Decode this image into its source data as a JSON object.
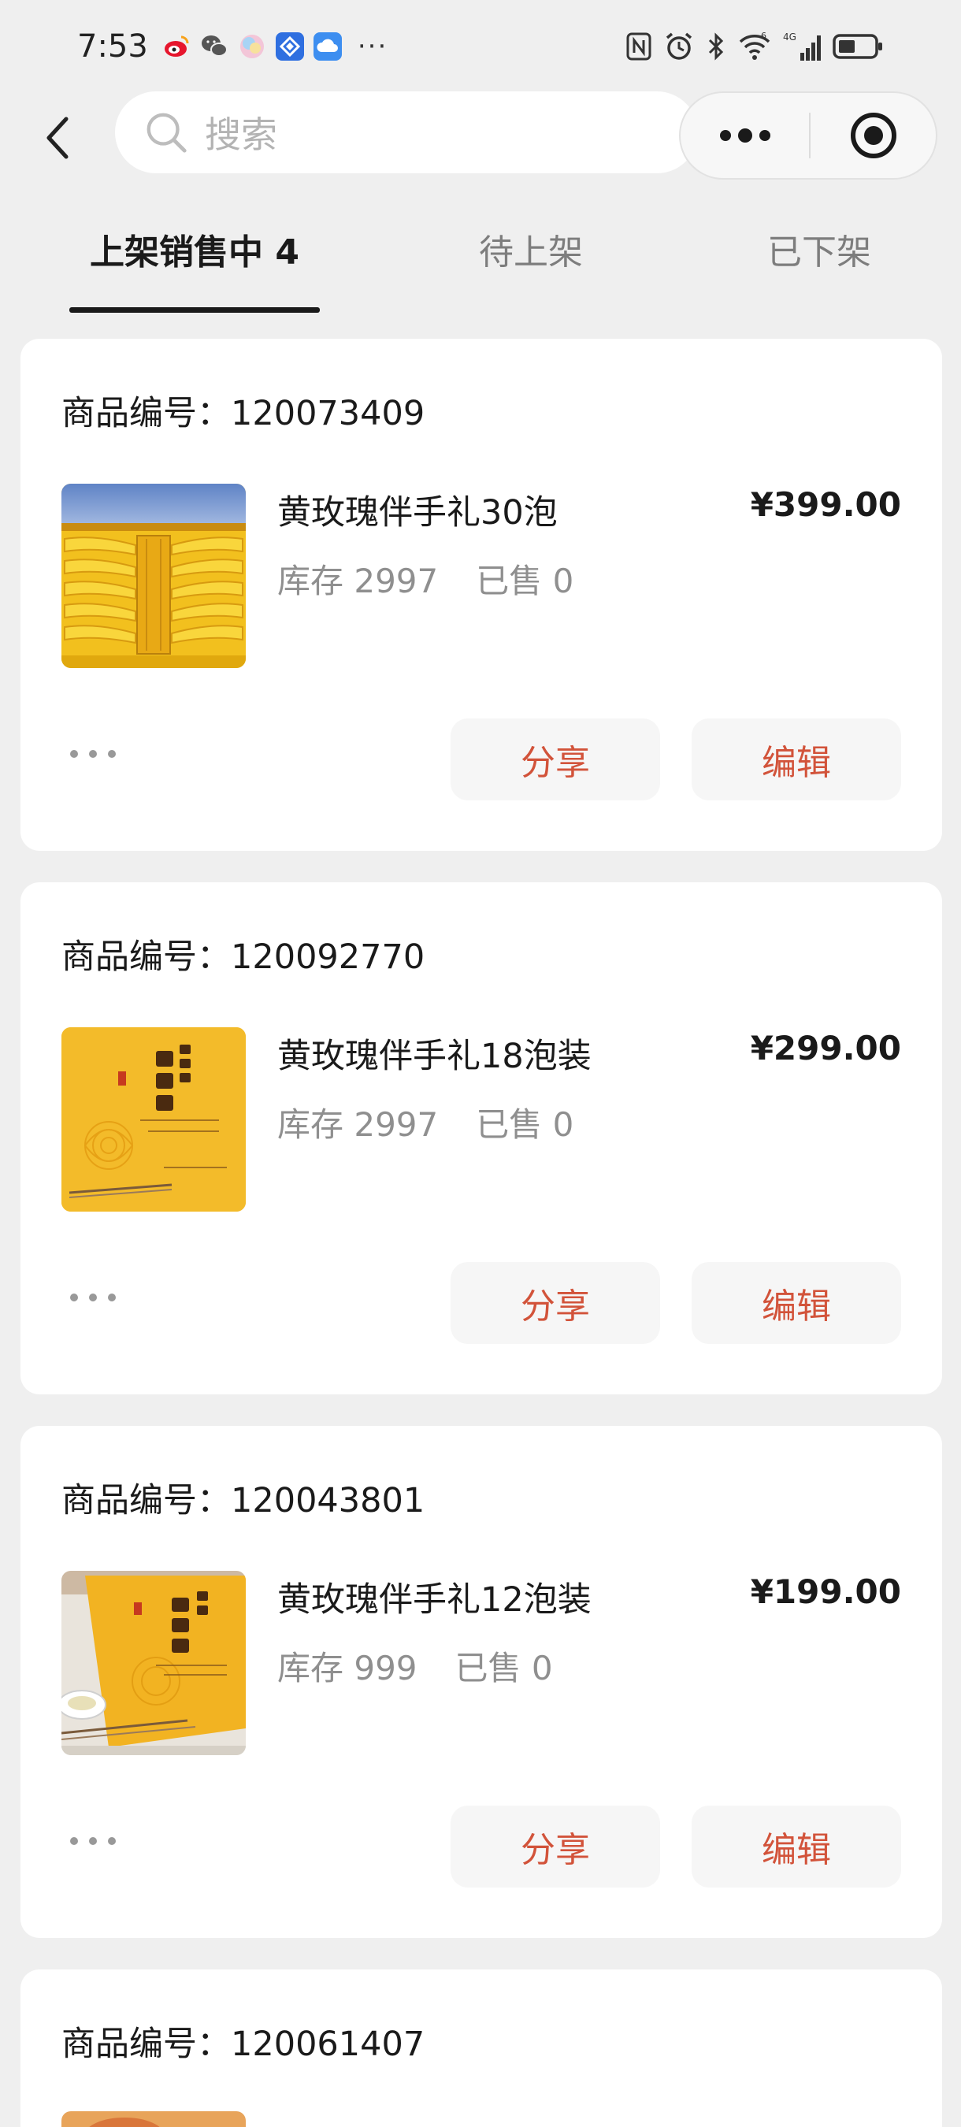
{
  "status_bar": {
    "time": "7:53",
    "more": "···",
    "notification_icons": [
      "weibo-icon",
      "wechat-icon",
      "color-ball-icon",
      "app-blue-icon",
      "cloud-icon"
    ],
    "system_icons": [
      "nfc-icon",
      "alarm-icon",
      "bluetooth-icon",
      "wifi-icon",
      "signal-4g-icon",
      "battery-icon"
    ],
    "network_label": "4G"
  },
  "nav": {
    "search_placeholder": "搜索"
  },
  "tabs": [
    {
      "label": "上架销售中 4",
      "active": true
    },
    {
      "label": "待上架",
      "active": false
    },
    {
      "label": "已下架",
      "active": false
    }
  ],
  "products": [
    {
      "id_label": "商品编号：",
      "id": "120073409",
      "name": "黄玫瑰伴手礼30泡",
      "price": "¥399.00",
      "stock": "库存 2997",
      "sold": "已售 0",
      "share_label": "分享",
      "edit_label": "编辑"
    },
    {
      "id_label": "商品编号：",
      "id": "120092770",
      "name": "黄玫瑰伴手礼18泡装",
      "price": "¥299.00",
      "stock": "库存 2997",
      "sold": "已售 0",
      "share_label": "分享",
      "edit_label": "编辑"
    },
    {
      "id_label": "商品编号：",
      "id": "120043801",
      "name": "黄玫瑰伴手礼12泡装",
      "price": "¥199.00",
      "stock": "库存 999",
      "sold": "已售 0",
      "share_label": "分享",
      "edit_label": "编辑"
    },
    {
      "id_label": "商品编号：",
      "id": "120061407"
    }
  ],
  "colors": {
    "accent": "#d2533a",
    "background": "#efefef",
    "card": "#ffffff",
    "product_box_yellow": "#f0b21c"
  }
}
